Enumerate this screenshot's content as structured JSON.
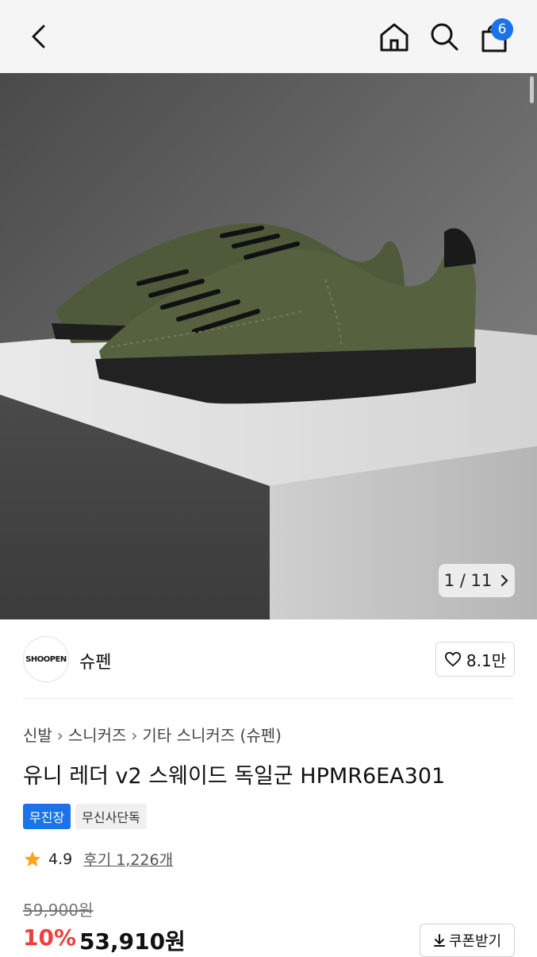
{
  "header": {
    "cart_count": "6"
  },
  "gallery": {
    "counter": "1 / 11"
  },
  "brand": {
    "logo_text": "SHOOPEN",
    "name": "슈펜",
    "likes": "8.1만"
  },
  "breadcrumb": [
    "신발",
    "스니커즈",
    "기타 스니커즈 (슈펜)"
  ],
  "product": {
    "title": "유니 레더 v2 스웨이드 독일군 HPMR6EA301",
    "badges": [
      "무진장",
      "무신사단독"
    ],
    "rating": "4.9",
    "reviews": "후기 1,226개",
    "original_price": "59,900원",
    "discount": "10%",
    "sale_price": "53,910원",
    "coupon_label": "쿠폰받기"
  },
  "colors": {
    "accent_blue": "#1a73e8",
    "discount_red": "#f03e3e",
    "star": "#f5a623"
  }
}
